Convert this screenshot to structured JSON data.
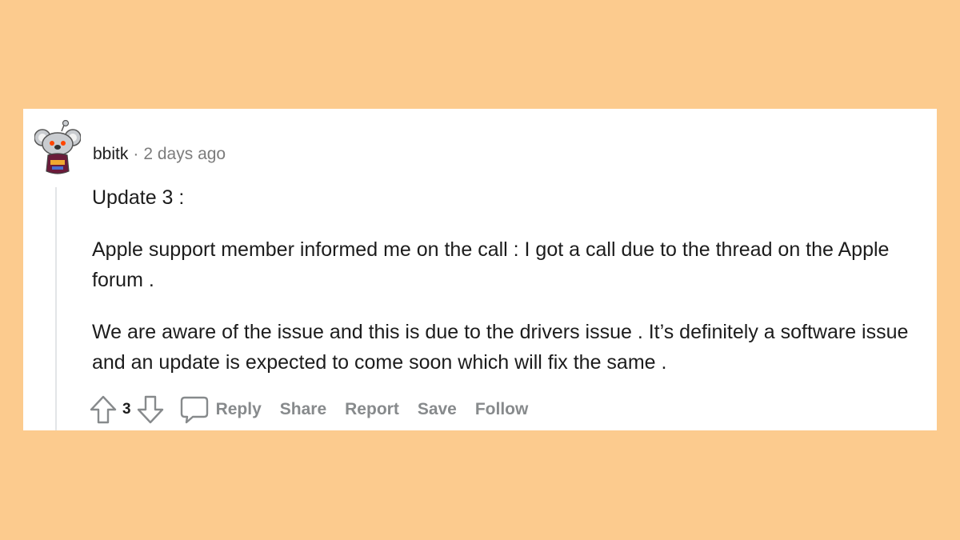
{
  "comment": {
    "author": "bbitk",
    "separator": "·",
    "time_ago": "2 days ago",
    "paragraphs": [
      "Update 3 :",
      "Apple support member informed me on the call : I got a call due to the thread on the Apple forum .",
      "We are aware of the issue and this is due to the drivers issue . It’s definitely a software issue and an update is expected to come soon which will fix the same ."
    ]
  },
  "actions": {
    "upvote_icon": "arrow-up-icon",
    "vote_count": "3",
    "downvote_icon": "arrow-down-icon",
    "reply_icon": "speech-bubble-icon",
    "reply_label": "Reply",
    "share_label": "Share",
    "report_label": "Report",
    "save_label": "Save",
    "follow_label": "Follow"
  },
  "colors": {
    "background": "#fccb8e",
    "card": "#ffffff",
    "text": "#1c1c1c",
    "muted": "#7c7c7c",
    "action": "#878a8c"
  }
}
